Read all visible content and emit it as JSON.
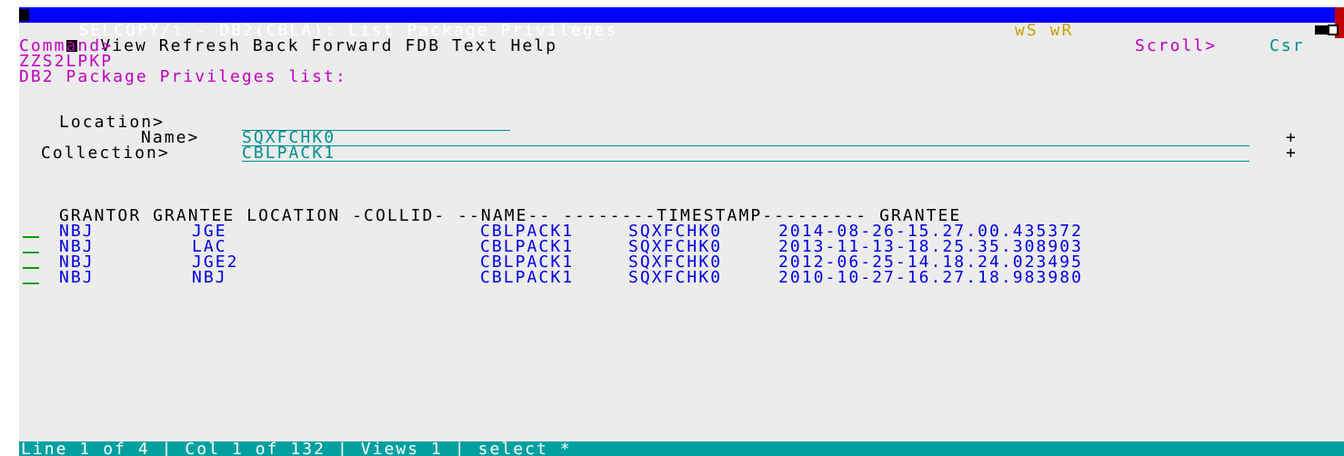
{
  "title": "SELCOPY/i - DB2(CBLA): List Package Privileges",
  "menu": [
    "View",
    "Refresh",
    "Back",
    "Forward",
    "FDB",
    "Text",
    "Help"
  ],
  "indicators": "wS wR",
  "command_label": "Command>",
  "scroll_label": "Scroll>",
  "scroll_value": "Csr",
  "panel_id": "ZZS2LPKP",
  "heading": "DB2 Package Privileges list:",
  "filters": {
    "location_label": "Location>",
    "location_value": "",
    "name_label": "Name>",
    "name_value": "SQXFCHK0",
    "collection_label": "Collection>",
    "collection_value": "CBLPACK1",
    "plus": "+"
  },
  "columns_header": "GRANTOR GRANTEE LOCATION -COLLID- --NAME-- --------TIMESTAMP--------- GRANTEE",
  "rows": [
    {
      "grantor": "NBJ",
      "grantee": "JGE",
      "location": "",
      "collid": "CBLPACK1",
      "name": "SQXFCHK0",
      "timestamp": "2014-08-26-15.27.00.435372"
    },
    {
      "grantor": "NBJ",
      "grantee": "LAC",
      "location": "",
      "collid": "CBLPACK1",
      "name": "SQXFCHK0",
      "timestamp": "2013-11-13-18.25.35.308903"
    },
    {
      "grantor": "NBJ",
      "grantee": "JGE2",
      "location": "",
      "collid": "CBLPACK1",
      "name": "SQXFCHK0",
      "timestamp": "2012-06-25-14.18.24.023495"
    },
    {
      "grantor": "NBJ",
      "grantee": "NBJ",
      "location": "",
      "collid": "CBLPACK1",
      "name": "SQXFCHK0",
      "timestamp": "2010-10-27-16.27.18.983980"
    }
  ],
  "status_bar": "Line 1 of 4 | Col 1 of 132 | Views 1 | select *",
  "colors": {
    "title_bg": "#0000ff",
    "status_bg": "#00a0a0",
    "data": "#0000e0",
    "input": "#008f8f",
    "heading": "#c000c0"
  }
}
